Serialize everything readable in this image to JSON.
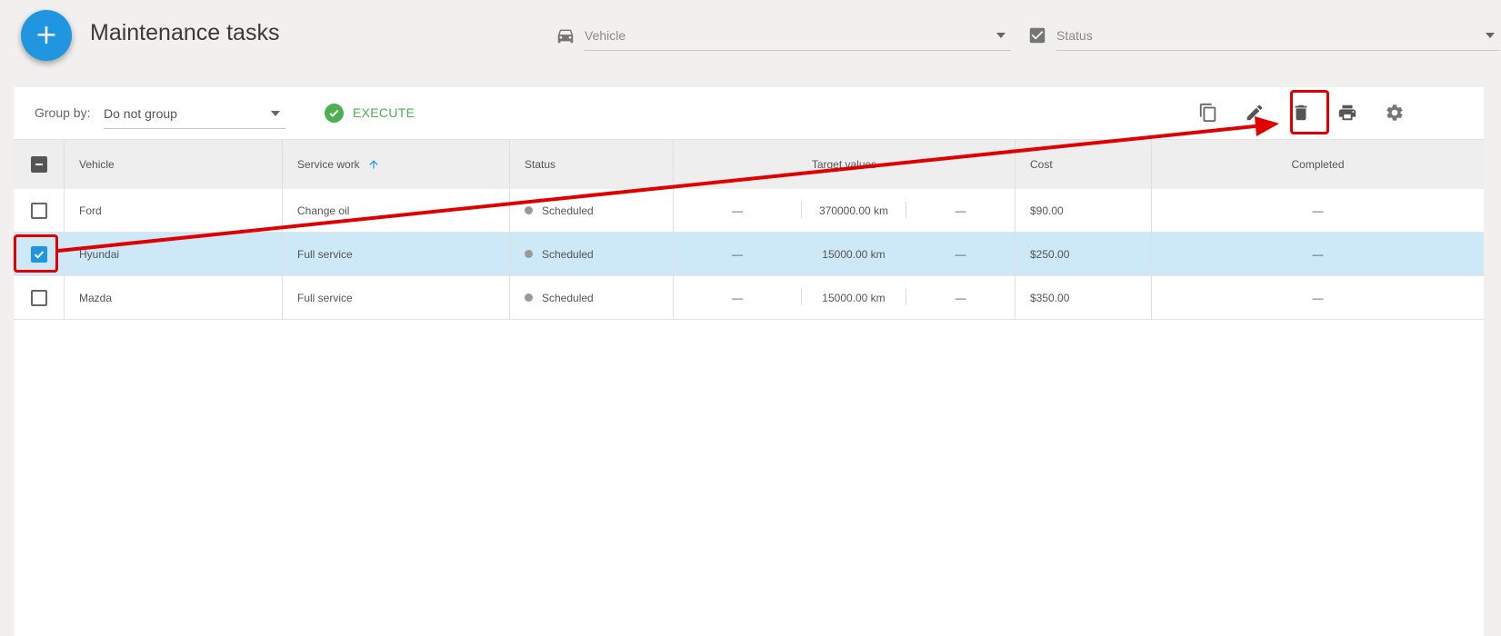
{
  "header": {
    "add_symbol": "+",
    "title": "Maintenance tasks",
    "vehicle_filter": {
      "placeholder": "Vehicle",
      "icon": "car-icon"
    },
    "status_filter": {
      "placeholder": "Status",
      "icon": "checkbox-icon"
    }
  },
  "toolbar": {
    "group_by_label": "Group by:",
    "group_by_value": "Do not group",
    "execute_label": "EXECUTE",
    "actions": [
      "copy-icon",
      "edit-icon",
      "delete-icon",
      "print-icon",
      "settings-icon"
    ]
  },
  "table": {
    "columns": {
      "vehicle": "Vehicle",
      "service_work": "Service work",
      "status": "Status",
      "target_values": "Target values",
      "cost": "Cost",
      "completed": "Completed"
    },
    "sort": {
      "column": "service_work",
      "direction": "ascending"
    },
    "rows": [
      {
        "vehicle": "Ford",
        "service_work": "Change oil",
        "status": "Scheduled",
        "target_left": "—",
        "target_mid": "370000.00 km",
        "target_right": "—",
        "cost": "$90.00",
        "completed": "—",
        "selected": false
      },
      {
        "vehicle": "Hyundai",
        "service_work": "Full service",
        "status": "Scheduled",
        "target_left": "—",
        "target_mid": "15000.00 km",
        "target_right": "—",
        "cost": "$250.00",
        "completed": "—",
        "selected": true
      },
      {
        "vehicle": "Mazda",
        "service_work": "Full service",
        "status": "Scheduled",
        "target_left": "—",
        "target_mid": "15000.00 km",
        "target_right": "—",
        "cost": "$350.00",
        "completed": "—",
        "selected": false
      }
    ]
  },
  "colors": {
    "primary": "#2196e0",
    "execute": "#4caf50",
    "annotation": "#e00000",
    "selected_row": "#cde8f6"
  }
}
